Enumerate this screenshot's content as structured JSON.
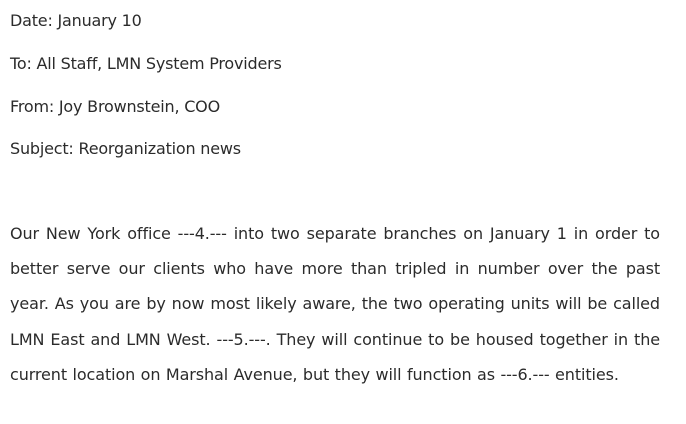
{
  "memo": {
    "date": "Date: January 10",
    "to": "To: All Staff, LMN System Providers",
    "from": "From: Joy Brownstein, COO",
    "subject": "Subject: Reorganization news",
    "body": "Our New York office ---4.--- into two separate branches on January 1 in order to better serve our clients who have more than tripled in number over the past year. As you are by now most likely aware, the two operating units will be called LMN East and LMN West. ---5.---. They will continue to be housed together in the current location on Marshal Avenue, but they will function as ---6.--- entities."
  }
}
